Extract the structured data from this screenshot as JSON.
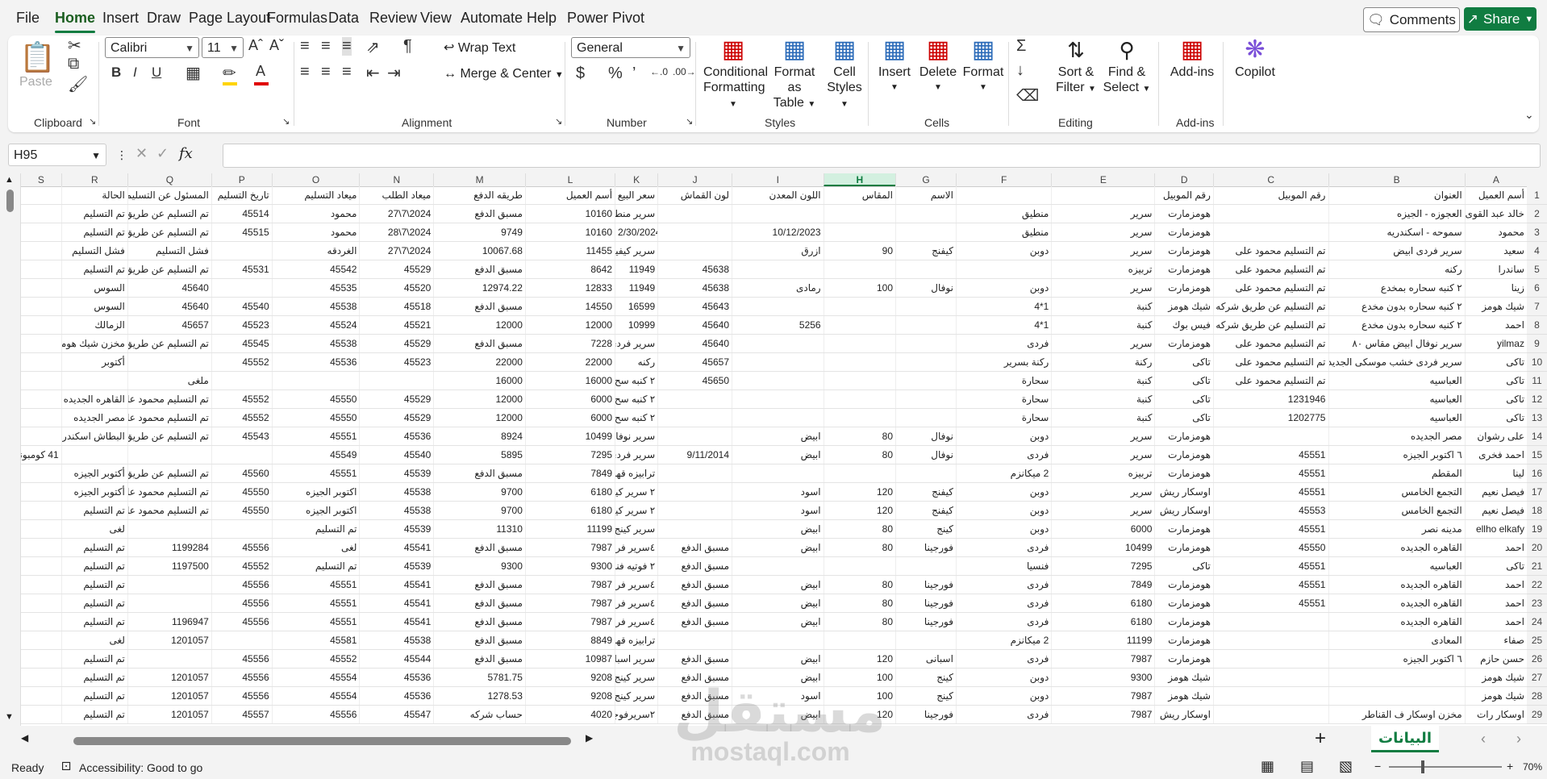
{
  "menu": {
    "items": [
      "File",
      "Home",
      "Insert",
      "Draw",
      "Page Layout",
      "Formulas",
      "Data",
      "Review",
      "View",
      "Automate",
      "Help",
      "Power Pivot"
    ],
    "active": "Home",
    "comments_label": "Comments",
    "share_label": "Share"
  },
  "ribbon": {
    "clipboard": {
      "label": "Clipboard",
      "paste": "Paste"
    },
    "font": {
      "label": "Font",
      "name": "Calibri",
      "size": "11"
    },
    "alignment": {
      "label": "Alignment",
      "wrap": "Wrap Text",
      "merge": "Merge & Center"
    },
    "number": {
      "label": "Number",
      "format": "General"
    },
    "styles": {
      "label": "Styles",
      "conditional": "Conditional",
      "formatting": "Formatting",
      "format_as": "Format as",
      "table": "Table",
      "cell": "Cell",
      "cell_styles": "Styles"
    },
    "cells": {
      "label": "Cells",
      "insert": "Insert",
      "delete": "Delete",
      "format": "Format"
    },
    "editing": {
      "label": "Editing",
      "sort": "Sort &",
      "filter": "Filter",
      "find": "Find &",
      "select": "Select"
    },
    "addins": {
      "label": "Add-ins",
      "addins_btn": "Add-ins"
    },
    "copilot": "Copilot"
  },
  "formula_bar": {
    "name_box": "H95",
    "fx": "fx",
    "value": ""
  },
  "columns": [
    {
      "id": "S",
      "w": 42
    },
    {
      "id": "R",
      "w": 68
    },
    {
      "id": "Q",
      "w": 86
    },
    {
      "id": "P",
      "w": 62
    },
    {
      "id": "O",
      "w": 90
    },
    {
      "id": "N",
      "w": 76
    },
    {
      "id": "M",
      "w": 94
    },
    {
      "id": "L",
      "w": 92
    },
    {
      "id": "K",
      "w": 44
    },
    {
      "id": "J",
      "w": 76
    },
    {
      "id": "I",
      "w": 94
    },
    {
      "id": "H",
      "w": 74
    },
    {
      "id": "G",
      "w": 62
    },
    {
      "id": "F",
      "w": 98
    },
    {
      "id": "E",
      "w": 106
    },
    {
      "id": "D",
      "w": 60
    },
    {
      "id": "C",
      "w": 118
    },
    {
      "id": "B",
      "w": 140
    },
    {
      "id": "A",
      "w": 64
    }
  ],
  "selected_column": "H",
  "rows": [
    {
      "n": "1",
      "c": [
        "",
        "الحالة",
        "المسئول عن التسليم",
        "تاريخ التسليم",
        "ميعاد التسليم",
        "ميعاد الطلب",
        "طريقه الدفع",
        "أسم العميل",
        "سعر البيع",
        "لون القماش",
        "اللون المعدن",
        "المقاس",
        "الاسم",
        "",
        "",
        "رقم الموبيل",
        "رقم الموبيل",
        "العنوان",
        "أسم العميل"
      ]
    },
    {
      "n": "2",
      "c": [
        "",
        "تم التسليم",
        "تم التسليم عن طريق شر",
        "45514",
        "محمود",
        "27\\7\\2024",
        "مسبق الدفع",
        "10160",
        "سرير منطيق",
        "",
        "",
        "",
        "",
        "منطيق",
        "سرير",
        "هومزمارت",
        "",
        "العجوزه - الجيزه",
        "خالد عبد القوى"
      ]
    },
    {
      "n": "3",
      "c": [
        "",
        "تم التسليم",
        "تم التسليم عن طريق شر",
        "45515",
        "محمود",
        "28\\7\\2024",
        "9749",
        "10160",
        "2/30/2024",
        "",
        "10/12/2023",
        "",
        "",
        "منطيق",
        "سرير",
        "هومزمارت",
        "",
        "سموحه - اسكندريه",
        "محمود"
      ]
    },
    {
      "n": "4",
      "c": [
        "",
        "فشل التسليم",
        "فشل التسليم",
        "",
        "الغردقه",
        "27\\7\\2024",
        "10067.68",
        "11455",
        "سرير كيفينج",
        "",
        "ازرق",
        "90",
        "كيفنج",
        "دوبن",
        "سرير",
        "هومزمارت",
        "تم التسليم محمود على",
        "سرير فردى ابيض",
        "سعيد"
      ]
    },
    {
      "n": "5",
      "c": [
        "",
        "تم التسليم",
        "تم التسليم عن طريق شر",
        "45531",
        "45542",
        "45529",
        "مسبق الدفع",
        "8642",
        "11949",
        "45638",
        "",
        "",
        "",
        "",
        "تربيزه",
        "هومزمارت",
        "تم التسليم محمود على",
        "ركنه",
        "ساندرا"
      ]
    },
    {
      "n": "6",
      "c": [
        "",
        "السوس",
        "45640",
        "",
        "45535",
        "45520",
        "12974.22",
        "12833",
        "11949",
        "45638",
        "رمادى",
        "100",
        "نوفال",
        "دوبن",
        "سرير",
        "هومزمارت",
        "تم التسليم محمود على",
        "٢ كنبه سحاره بمخدع",
        "زينا"
      ]
    },
    {
      "n": "7",
      "c": [
        "",
        "السوس",
        "45640",
        "45540",
        "45538",
        "45518",
        "مسبق الدفع",
        "14550",
        "16599",
        "45643",
        "",
        "",
        "",
        "4*1",
        "كنبة",
        "شيك هومز",
        "تم التسليم عن طريق شركه شحن",
        "٢ كنبه سحاره بدون مخدع",
        "شيك هومز"
      ]
    },
    {
      "n": "8",
      "c": [
        "",
        "الزمالك",
        "45657",
        "45523",
        "45524",
        "45521",
        "12000",
        "12000",
        "10999",
        "45640",
        "5256",
        "",
        "",
        "4*1",
        "كنبة",
        "فيس بوك",
        "تم التسليم عن طريق شركه شحن",
        "٢ كنبه سحاره بدون مخدع",
        "احمد"
      ]
    },
    {
      "n": "9",
      "c": [
        "",
        "مخزن شيك هومز",
        "تم التسليم عن طريق شر",
        "45545",
        "45538",
        "45529",
        "مسبق الدفع",
        "7228",
        "سرير فردى ا",
        "45640",
        "",
        "",
        "",
        "فردى",
        "سرير",
        "هومزمارت",
        "تم التسليم محمود على",
        "سرير نوفال ابيض مقاس ٨٠",
        "yilmaz"
      ]
    },
    {
      "n": "10",
      "c": [
        "",
        "أكتوبر",
        "",
        "45552",
        "45536",
        "45523",
        "22000",
        "22000",
        "ركنه",
        "45657",
        "",
        "",
        "",
        "ركنة بسرير",
        "ركنة",
        "تاكى",
        "تم التسليم محمود على",
        "سرير فردى خشب موسكى الجديد ابيض",
        "تاكى"
      ]
    },
    {
      "n": "11",
      "c": [
        "",
        "",
        "ملغى",
        "",
        "",
        "",
        "16000",
        "16000",
        "٢ كنبه سح",
        "45650",
        "",
        "",
        "",
        "سحارة",
        "كنبة",
        "تاكى",
        "تم التسليم محمود على",
        "العباسيه",
        "تاكى"
      ]
    },
    {
      "n": "12",
      "c": [
        "",
        "القاهره الجديده",
        "تم التسليم محمود على",
        "45552",
        "45550",
        "45529",
        "12000",
        "6000",
        "٢ كنبه سح",
        "",
        "",
        "",
        "",
        "سحارة",
        "كنبة",
        "تاكى",
        "1231946",
        "العباسيه",
        "تاكى"
      ]
    },
    {
      "n": "13",
      "c": [
        "",
        "مصر الجديده",
        "تم التسليم محمود على",
        "45552",
        "45550",
        "45529",
        "12000",
        "6000",
        "٢ كنبه سح",
        "",
        "",
        "",
        "",
        "سحارة",
        "كنبة",
        "تاكى",
        "1202775",
        "العباسيه",
        "تاكى"
      ]
    },
    {
      "n": "14",
      "c": [
        "",
        "البطاش اسكندريه",
        "تم التسليم عن طريق شر",
        "45543",
        "45551",
        "45536",
        "8924",
        "10499",
        "سرير نوفال ا",
        "",
        "ابيض",
        "80",
        "نوفال",
        "دوبن",
        "سرير",
        "هومزمارت",
        "",
        "مصر الجديده",
        "على رشوان"
      ]
    },
    {
      "n": "15",
      "c": [
        "41 كومبوند جولدن جستس الد",
        "",
        "",
        "",
        "45549",
        "45540",
        "5895",
        "7295",
        "سرير فردى ا",
        "9/11/2014",
        "ابيض",
        "80",
        "نوفال",
        "فردى",
        "سرير",
        "هومزمارت",
        "45551",
        "٦ اكتوبر الجيزه",
        "احمد فخرى"
      ]
    },
    {
      "n": "16",
      "c": [
        "",
        "أكتوبر الجيزه",
        "تم التسليم عن طريق شر",
        "45560",
        "45551",
        "45539",
        "مسبق الدفع",
        "7849",
        "ترابيزه قهوه",
        "",
        "",
        "",
        "",
        "2 ميكانزم",
        "تربيزه",
        "هومزمارت",
        "45551",
        "المقطم",
        "لينا"
      ]
    },
    {
      "n": "17",
      "c": [
        "",
        "أكتوبر الجيزه",
        "تم التسليم محمود على",
        "45550",
        "اكتوبر الجيزه",
        "45538",
        "9700",
        "6180",
        "٢ سرير كيفة",
        "",
        "اسود",
        "120",
        "كيفنج",
        "دوبن",
        "سرير",
        "اوسكار ريش",
        "45551",
        "التجمع الخامس",
        "فيصل نعيم"
      ]
    },
    {
      "n": "18",
      "c": [
        "",
        "تم التسليم",
        "تم التسليم محمود على",
        "45550",
        "اكتوبر الجيزه",
        "45538",
        "9700",
        "6180",
        "٢ سرير كيفة",
        "",
        "اسود",
        "120",
        "كيفنج",
        "دوبن",
        "سرير",
        "اوسكار ريش",
        "45553",
        "التجمع الخامس",
        "فيصل نعيم"
      ]
    },
    {
      "n": "19",
      "c": [
        "",
        "لغى",
        "",
        "",
        "تم التسليم",
        "45539",
        "11310",
        "11199",
        "سرير كينج ا",
        "",
        "ابيض",
        "80",
        "كينج",
        "دوبن",
        "6000",
        "هومزمارت",
        "45551",
        "مدينه نصر",
        "ellho elkafy"
      ]
    },
    {
      "n": "20",
      "c": [
        "",
        "تم التسليم",
        "1199284",
        "45556",
        "لغى",
        "45541",
        "مسبق الدفع",
        "7987",
        "٤سرير فردى",
        "مسبق الدفع",
        "ابيض",
        "80",
        "فورجينا",
        "فردى",
        "10499",
        "هومزمارت",
        "45550",
        "القاهره الجديده",
        "احمد"
      ]
    },
    {
      "n": "21",
      "c": [
        "",
        "تم التسليم",
        "1197500",
        "45552",
        "تم التسليم",
        "45539",
        "9300",
        "9300",
        "٢ فوتيه فنر",
        "مسبق الدفع",
        "",
        "",
        "",
        "فنسيا",
        "7295",
        "تاكى",
        "45551",
        "العباسيه",
        "تاكى"
      ]
    },
    {
      "n": "22",
      "c": [
        "",
        "تم التسليم",
        "",
        "45556",
        "45551",
        "45541",
        "مسبق الدفع",
        "7987",
        "٤سرير فردى",
        "مسبق الدفع",
        "ابيض",
        "80",
        "فورجينا",
        "فردى",
        "7849",
        "هومزمارت",
        "45551",
        "القاهره الجديده",
        "احمد"
      ]
    },
    {
      "n": "23",
      "c": [
        "",
        "تم التسليم",
        "",
        "45556",
        "45551",
        "45541",
        "مسبق الدفع",
        "7987",
        "٤سرير فردى",
        "مسبق الدفع",
        "ابيض",
        "80",
        "فورجينا",
        "فردى",
        "6180",
        "هومزمارت",
        "45551",
        "القاهره الجديده",
        "احمد"
      ]
    },
    {
      "n": "24",
      "c": [
        "",
        "تم التسليم",
        "1196947",
        "45556",
        "45551",
        "45541",
        "مسبق الدفع",
        "7987",
        "٤سرير فردى",
        "مسبق الدفع",
        "ابيض",
        "80",
        "فورجينا",
        "فردى",
        "6180",
        "هومزمارت",
        "",
        "القاهره الجديده",
        "احمد"
      ]
    },
    {
      "n": "25",
      "c": [
        "",
        "لغى",
        "1201057",
        "",
        "45581",
        "45538",
        "مسبق الدفع",
        "8849",
        "ترابيزه قهوه",
        "",
        "",
        "",
        "",
        "2 ميكانزم",
        "11199",
        "هومزمارت",
        "",
        "المعادى",
        "صفاء"
      ]
    },
    {
      "n": "26",
      "c": [
        "",
        "تم التسليم",
        "",
        "45556",
        "45552",
        "45544",
        "مسبق الدفع",
        "10987",
        "سرير اسباني",
        "مسبق الدفع",
        "ابيض",
        "120",
        "اسبانى",
        "فردى",
        "7987",
        "هومزمارت",
        "",
        "٦ اكتوبر الجيزه",
        "حسن حازم"
      ]
    },
    {
      "n": "27",
      "c": [
        "",
        "تم التسليم",
        "1201057",
        "45556",
        "45554",
        "45536",
        "5781.75",
        "9208",
        "سرير كينج ا",
        "مسبق الدفع",
        "ابيض",
        "100",
        "كينج",
        "دوبن",
        "9300",
        "شيك هومز",
        "",
        "",
        "شيك هومز"
      ]
    },
    {
      "n": "28",
      "c": [
        "",
        "تم التسليم",
        "1201057",
        "45556",
        "45554",
        "45536",
        "1278.53",
        "9208",
        "سرير كينج ا",
        "مسبق الدفع",
        "اسود",
        "100",
        "كينج",
        "دوبن",
        "7987",
        "شيك هومز",
        "",
        "",
        "شيك هومز"
      ]
    },
    {
      "n": "29",
      "c": [
        "",
        "تم التسليم",
        "1201057",
        "45557",
        "45556",
        "45547",
        "حساب شركه",
        "4020",
        "٢سريرفوجي",
        "مسبق الدفع",
        "ابيض",
        "120",
        "فورجينا",
        "فردى",
        "7987",
        "اوسكار ريش",
        "",
        "مخزن اوسكار ف القناطر",
        "اوسكار رات"
      ]
    }
  ],
  "sheet": {
    "tab_name": "البيانات",
    "add": "+"
  },
  "status": {
    "ready": "Ready",
    "accessibility": "Accessibility: Good to go",
    "zoom": "70%"
  },
  "watermark": {
    "main": "مستقل",
    "sub": "mostaql.com"
  }
}
